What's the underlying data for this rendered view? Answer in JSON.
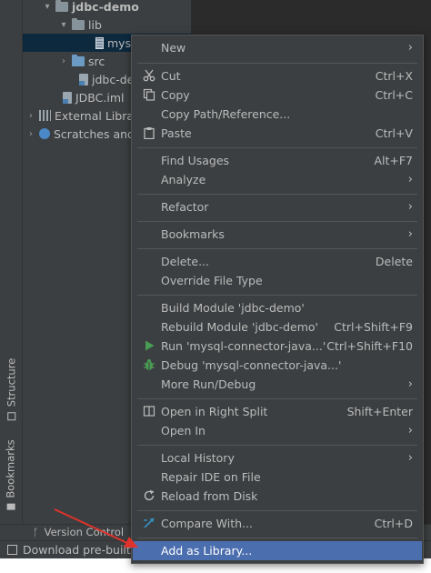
{
  "tool_strip": {
    "structure_label": "Structure",
    "bookmarks_label": "Bookmarks"
  },
  "project_tree": {
    "root": "jdbc-demo",
    "lib": "lib",
    "selected_file": "mys",
    "src": "src",
    "jdbc_file": "jdbc-de",
    "iml_file": "JDBC.iml",
    "external_libraries": "External Libra",
    "scratches": "Scratches and"
  },
  "bottom_bar": {
    "version_control": "Version Control"
  },
  "status_bar": {
    "message": "Download pre-built"
  },
  "menu": {
    "new": "New",
    "cut": "Cut",
    "cut_shortcut": "Ctrl+X",
    "copy": "Copy",
    "copy_shortcut": "Ctrl+C",
    "copy_path": "Copy Path/Reference...",
    "paste": "Paste",
    "paste_shortcut": "Ctrl+V",
    "find_usages": "Find Usages",
    "find_usages_shortcut": "Alt+F7",
    "analyze": "Analyze",
    "refactor": "Refactor",
    "bookmarks": "Bookmarks",
    "delete": "Delete...",
    "delete_shortcut": "Delete",
    "override_file_type": "Override File Type",
    "build_module": "Build Module 'jdbc-demo'",
    "rebuild_module": "Rebuild Module 'jdbc-demo'",
    "rebuild_shortcut": "Ctrl+Shift+F9",
    "run": "Run 'mysql-connector-java...'",
    "run_shortcut": "Ctrl+Shift+F10",
    "debug": "Debug 'mysql-connector-java...'",
    "more_run_debug": "More Run/Debug",
    "open_right_split": "Open in Right Split",
    "open_right_split_shortcut": "Shift+Enter",
    "open_in": "Open In",
    "local_history": "Local History",
    "repair_ide": "Repair IDE on File",
    "reload_from_disk": "Reload from Disk",
    "compare_with": "Compare With...",
    "compare_with_shortcut": "Ctrl+D",
    "add_as_library": "Add as Library..."
  },
  "colors": {
    "menu_bg": "#3c3f41",
    "highlight": "#4b6eaf",
    "annotation_arrow": "#e0322c"
  }
}
